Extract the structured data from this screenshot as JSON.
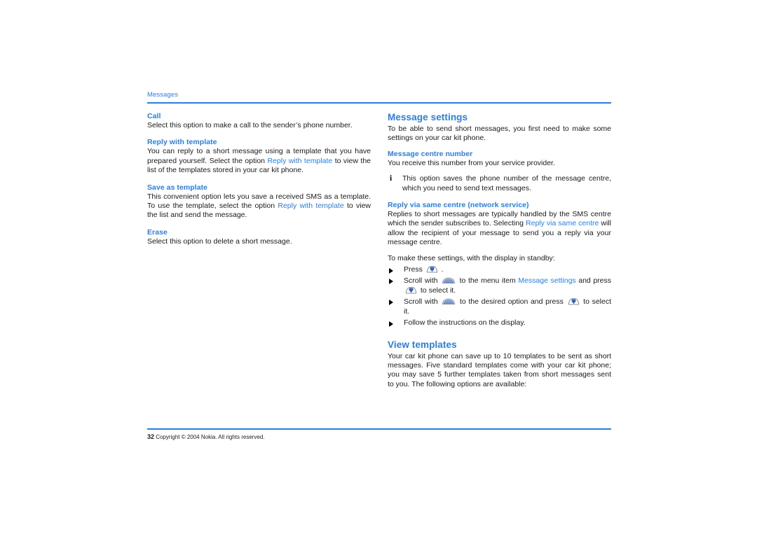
{
  "document": {
    "running_header": "Messages",
    "page_number": "32",
    "copyright": "Copyright © 2004 Nokia. All rights reserved.",
    "rule_color": "#2a7de1",
    "heading_color": "#2a7de1",
    "body_color": "#1a1a1a"
  },
  "left_column": {
    "blocks": [
      {
        "heading": "Call",
        "paragraph_pre": "Select this option to make a call to the sender’s phone number.",
        "link": "",
        "paragraph_post": ""
      },
      {
        "heading": "Reply with template",
        "paragraph_pre": "You can reply to a short message using a template that you have prepared yourself. Select the option ",
        "link": "Reply with template",
        "paragraph_post": " to view the list of the templates stored in your car kit phone."
      },
      {
        "heading": "Save as template",
        "paragraph_pre": "This convenient option lets you save a received SMS as a template. To use the template, select the option ",
        "link": "Reply with template",
        "paragraph_post": " to view the list and send the message."
      },
      {
        "heading": "Erase",
        "paragraph_pre": "Select this option to delete a short message.",
        "link": "",
        "paragraph_post": ""
      }
    ]
  },
  "right_column": {
    "section_message_settings": {
      "title": "Message settings",
      "intro": "To be able to send short messages, you first need to make some settings on your car kit phone.",
      "sub_message_centre_number": {
        "heading": "Message centre number",
        "paragraph": "You receive this number from your service provider."
      },
      "note": {
        "icon": "info-i-icon",
        "text": "This option saves the phone number of the message centre, which you need to send text messages."
      },
      "sub_reply_via_same_centre": {
        "heading": "Reply via same centre (network service)",
        "paragraph_pre": "Replies to short messages are typically handled by the SMS centre which the sender subscribes to. Selecting ",
        "link": "Reply via same centre",
        "paragraph_post": " will allow the recipient of your message to send you a reply via your message centre."
      },
      "steps_intro": "To make these settings, with the display in standby:",
      "steps": [
        {
          "text_1": "Press ",
          "icon_1": "select-key-icon",
          "text_2": " .",
          "icon_2": "",
          "text_3": "",
          "link": "",
          "text_4": ""
        },
        {
          "text_1": "Scroll with ",
          "icon_1": "scroll-key-icon",
          "text_2": " to the menu item ",
          "link": "Message settings",
          "text_3": " and press ",
          "icon_2": "select-key-icon",
          "text_4": " to select it."
        },
        {
          "text_1": "Scroll with ",
          "icon_1": "scroll-key-icon",
          "text_2": " to the desired option and press ",
          "link": "",
          "text_3": "",
          "icon_2": "select-key-icon",
          "text_4": " to select it."
        },
        {
          "text_1": "Follow the instructions on the display.",
          "icon_1": "",
          "text_2": "",
          "link": "",
          "text_3": "",
          "icon_2": "",
          "text_4": ""
        }
      ]
    },
    "section_view_templates": {
      "title": "View templates",
      "paragraph": "Your car kit phone can save up to 10 templates to be sent as short messages. Five standard templates come with your car kit phone; you may save 5 further templates taken from short messages sent to you. The following options are available:"
    }
  }
}
